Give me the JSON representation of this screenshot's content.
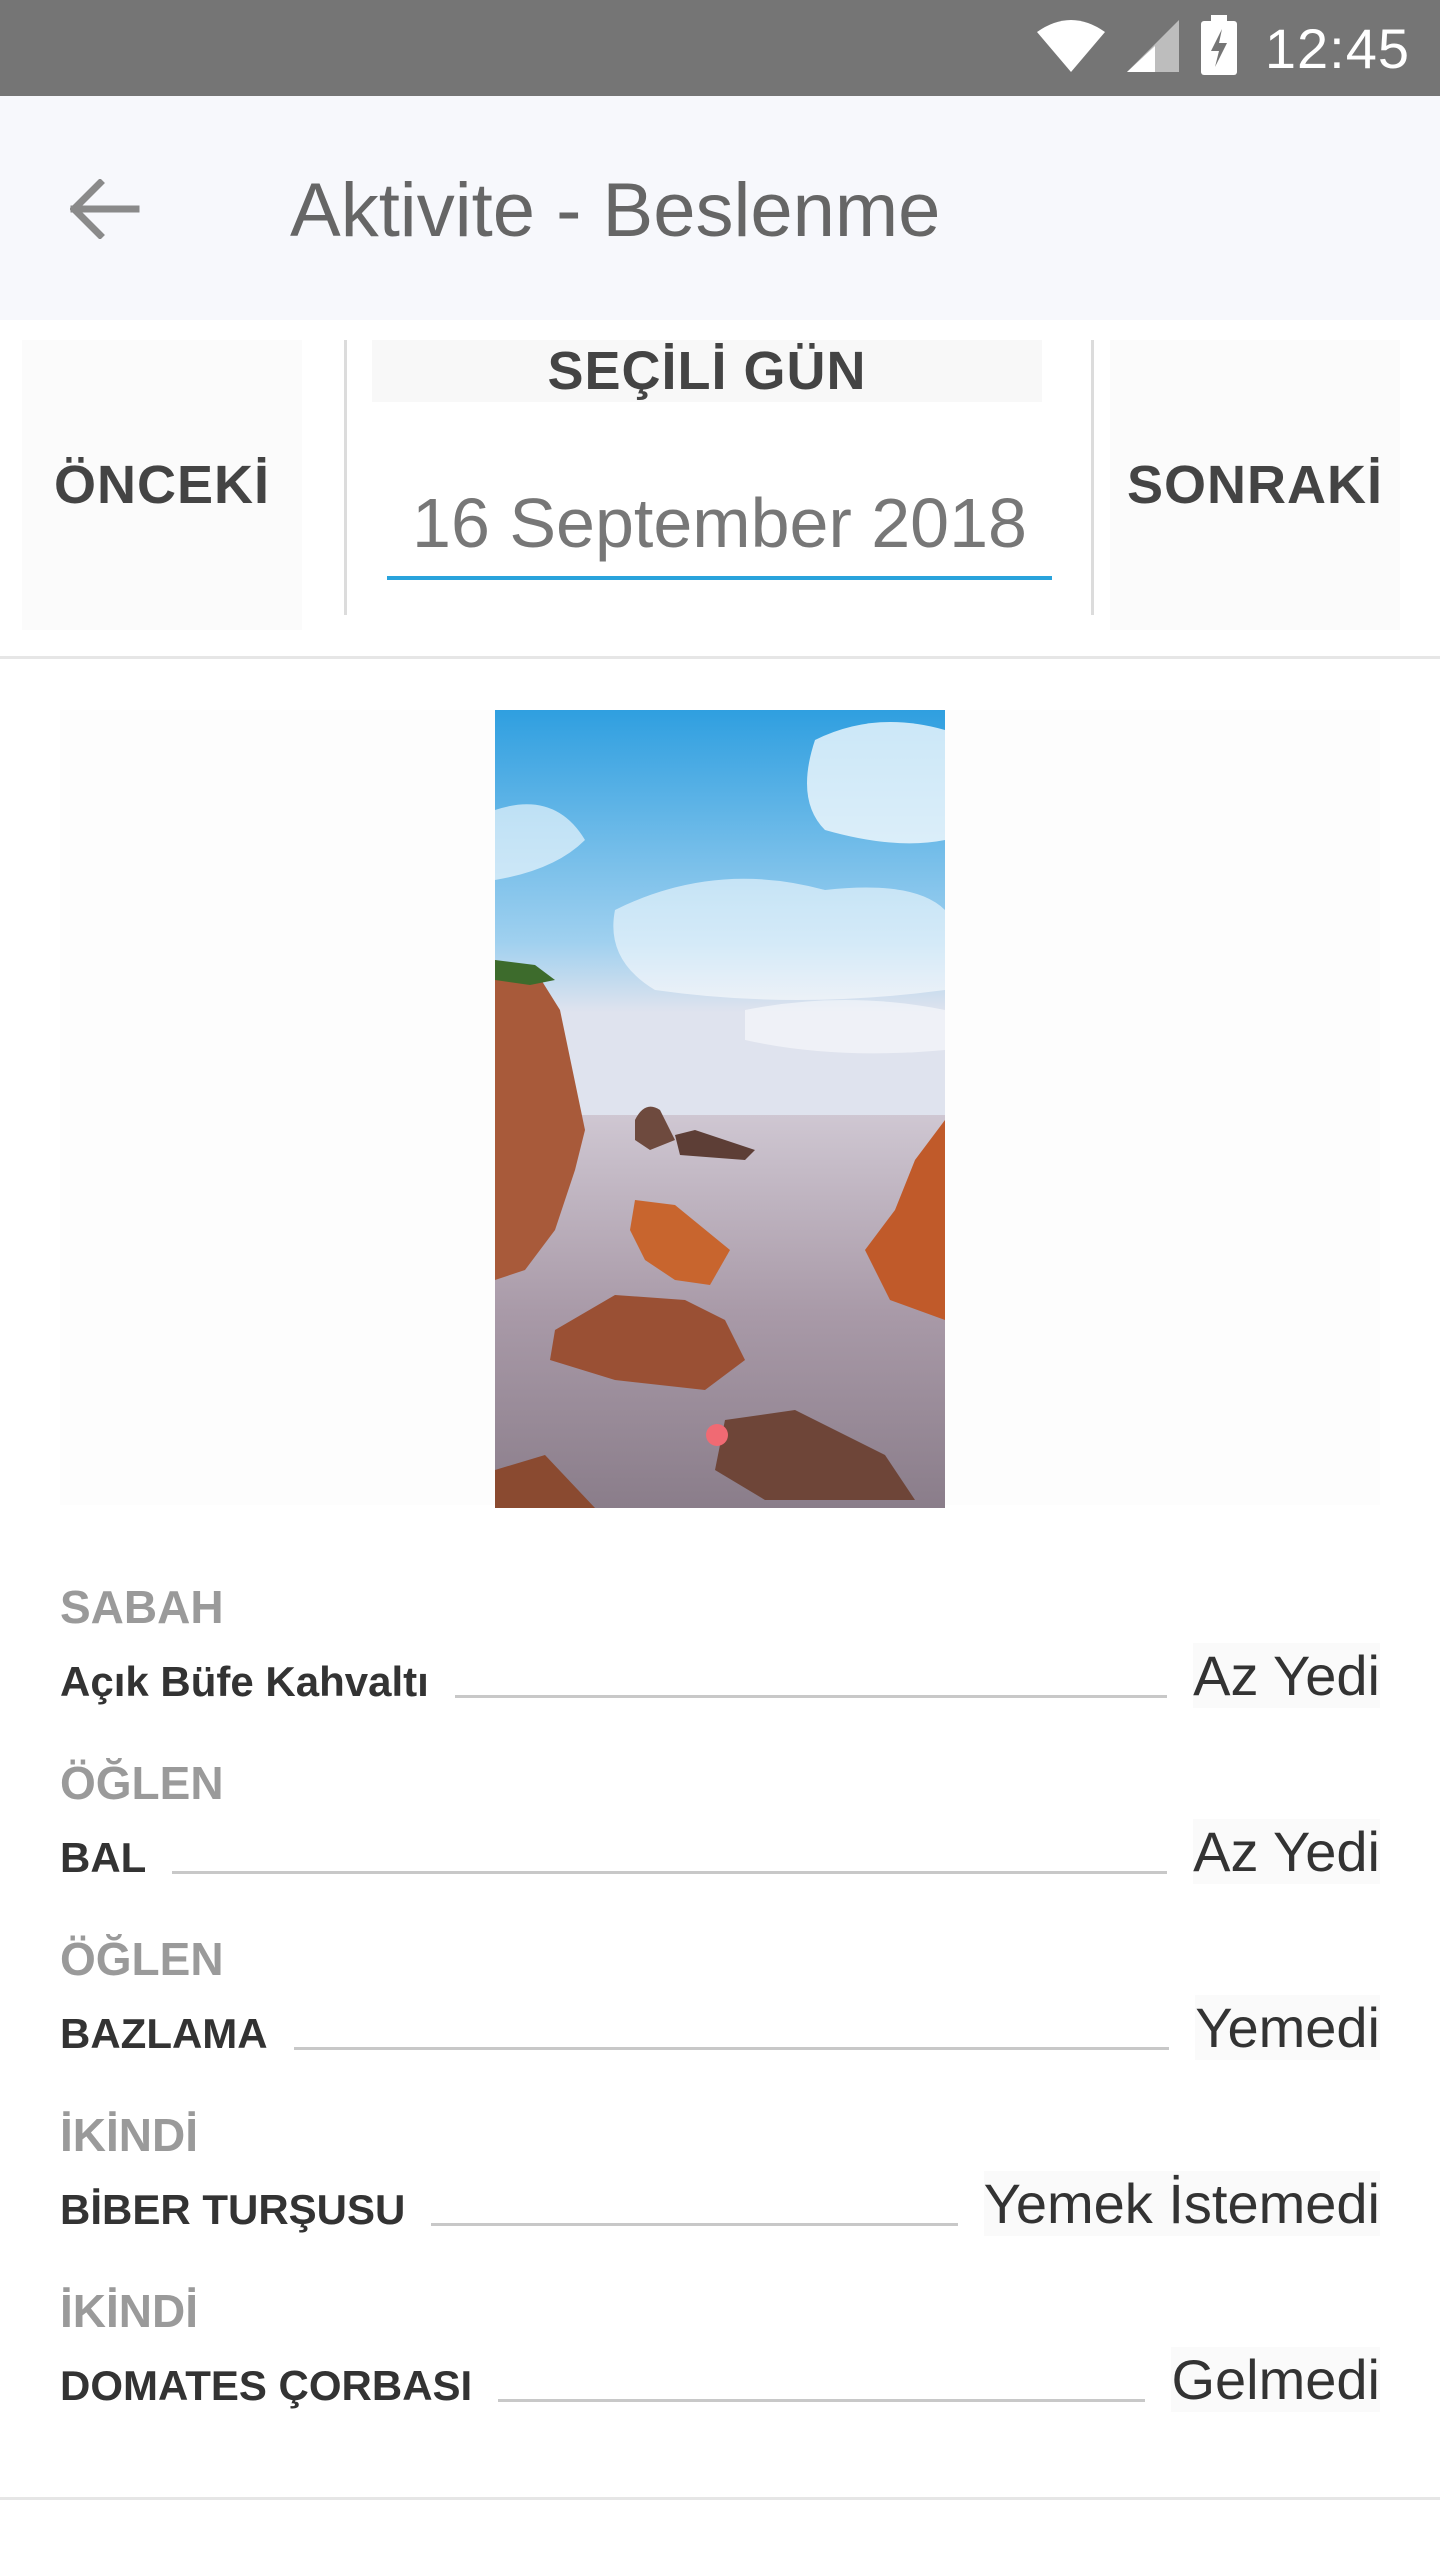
{
  "status_bar": {
    "time": "12:45",
    "icons": [
      "wifi-icon",
      "signal-icon",
      "battery-charging-icon"
    ]
  },
  "app_bar": {
    "title": "Aktivite - Beslenme",
    "back_icon": "arrow-left-icon"
  },
  "date_selector": {
    "prev_label": "ÖNCEKİ",
    "next_label": "SONRAKİ",
    "selected_day_label": "SEÇİLİ GÜN",
    "selected_date": "16 September 2018",
    "accent_color": "#29a3dc"
  },
  "photo": {
    "description_icon": "landscape-photo"
  },
  "meals": [
    {
      "period": "SABAH",
      "food": "Açık Büfe Kahvaltı",
      "status": "Az Yedi"
    },
    {
      "period": "ÖĞLEN",
      "food": "BAL",
      "status": "Az Yedi"
    },
    {
      "period": "ÖĞLEN",
      "food": "BAZLAMA",
      "status": "Yemedi"
    },
    {
      "period": "İKİNDİ",
      "food": "BİBER TURŞUSU",
      "status": "Yemek İstemedi"
    },
    {
      "period": "İKİNDİ",
      "food": "DOMATES ÇORBASI",
      "status": "Gelmedi"
    }
  ]
}
